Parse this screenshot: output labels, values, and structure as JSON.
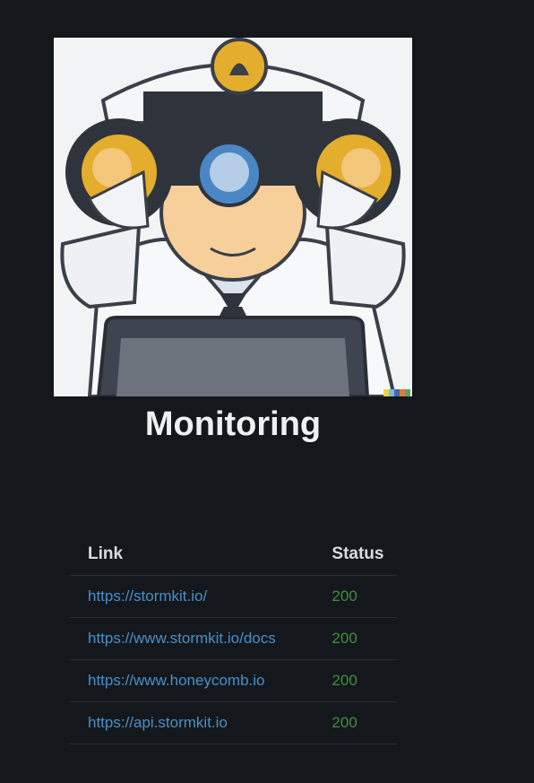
{
  "page": {
    "title": "Monitoring"
  },
  "hero": {
    "image": "sailor-with-binoculars-illustration"
  },
  "table": {
    "headers": {
      "link": "Link",
      "status": "Status"
    },
    "rows": [
      {
        "link": "https://stormkit.io/",
        "status": "200"
      },
      {
        "link": "https://www.stormkit.io/docs",
        "status": "200"
      },
      {
        "link": "https://www.honeycomb.io",
        "status": "200"
      },
      {
        "link": "https://api.stormkit.io",
        "status": "200"
      }
    ]
  },
  "colors": {
    "background": "#14181d",
    "link": "#4a8fc7",
    "status_ok": "#3f8f3a",
    "title": "#eef0f3"
  }
}
